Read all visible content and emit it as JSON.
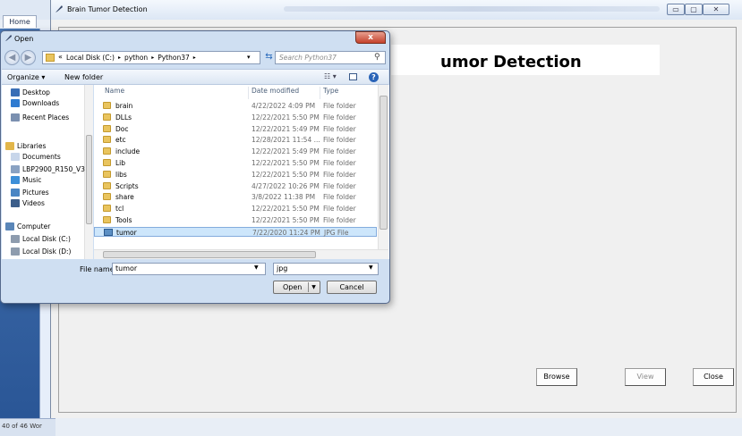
{
  "background": {
    "home_tab": "Home",
    "status": "40 of 46   Wor"
  },
  "app": {
    "title": "Brain Tumor Detection",
    "heading": "umor Detection",
    "buttons": {
      "browse": "Browse",
      "view": "View",
      "close": "Close"
    },
    "window_controls": {
      "minimize": "▭",
      "maximize": "▢",
      "close": "✕"
    }
  },
  "dialog": {
    "title": "Open",
    "close": "x",
    "address": {
      "chevron": "«",
      "crumbs": [
        "Local Disk (C:)",
        "python",
        "Python37"
      ],
      "separator": "▸"
    },
    "search_placeholder": "Search Python37",
    "toolbar": {
      "organize": "Organize ▾",
      "new_folder": "New folder",
      "views": "☷ ▾",
      "help": "?"
    },
    "nav_items": [
      {
        "label": "Desktop",
        "icon": "desktop-icon",
        "color": "#3a6fb6"
      },
      {
        "label": "Downloads",
        "icon": "downloads-icon",
        "color": "#2f7bd0"
      },
      {
        "label": "Recent Places",
        "icon": "recent-places-icon",
        "color": "#7b90b0"
      },
      {
        "label": "Libraries",
        "icon": "libraries-icon",
        "color": "#e2b64a"
      },
      {
        "label": "Documents",
        "icon": "documents-icon",
        "color": "#c8d6ea"
      },
      {
        "label": "LBP2900_R150_V3",
        "icon": "library-folder-icon",
        "color": "#8aa2c2"
      },
      {
        "label": "Music",
        "icon": "music-icon",
        "color": "#3d8fd8"
      },
      {
        "label": "Pictures",
        "icon": "pictures-icon",
        "color": "#4a86c4"
      },
      {
        "label": "Videos",
        "icon": "videos-icon",
        "color": "#3c5e8a"
      },
      {
        "label": "Computer",
        "icon": "computer-icon",
        "color": "#5a86b8"
      },
      {
        "label": "Local Disk (C:)",
        "icon": "disk-icon",
        "color": "#8e9cae"
      },
      {
        "label": "Local Disk (D:)",
        "icon": "disk-icon",
        "color": "#8e9cae"
      }
    ],
    "columns": {
      "name": "Name",
      "date": "Date modified",
      "type": "Type"
    },
    "files": [
      {
        "name": "brain",
        "date": "4/22/2022 4:09 PM",
        "type": "File folder",
        "kind": "folder"
      },
      {
        "name": "DLLs",
        "date": "12/22/2021 5:50 PM",
        "type": "File folder",
        "kind": "folder"
      },
      {
        "name": "Doc",
        "date": "12/22/2021 5:49 PM",
        "type": "File folder",
        "kind": "folder"
      },
      {
        "name": "etc",
        "date": "12/28/2021 11:54 ...",
        "type": "File folder",
        "kind": "folder"
      },
      {
        "name": "include",
        "date": "12/22/2021 5:49 PM",
        "type": "File folder",
        "kind": "folder"
      },
      {
        "name": "Lib",
        "date": "12/22/2021 5:50 PM",
        "type": "File folder",
        "kind": "folder"
      },
      {
        "name": "libs",
        "date": "12/22/2021 5:50 PM",
        "type": "File folder",
        "kind": "folder"
      },
      {
        "name": "Scripts",
        "date": "4/27/2022 10:26 PM",
        "type": "File folder",
        "kind": "folder"
      },
      {
        "name": "share",
        "date": "3/8/2022 11:38 PM",
        "type": "File folder",
        "kind": "folder"
      },
      {
        "name": "tcl",
        "date": "12/22/2021 5:50 PM",
        "type": "File folder",
        "kind": "folder"
      },
      {
        "name": "Tools",
        "date": "12/22/2021 5:50 PM",
        "type": "File folder",
        "kind": "folder"
      },
      {
        "name": "tumor",
        "date": "7/22/2020 11:24 PM",
        "type": "JPG File",
        "kind": "image",
        "selected": true
      }
    ],
    "file_name_label": "File name:",
    "file_name_value": "tumor",
    "file_type_value": "jpg",
    "open_label": "Open",
    "cancel_label": "Cancel"
  }
}
